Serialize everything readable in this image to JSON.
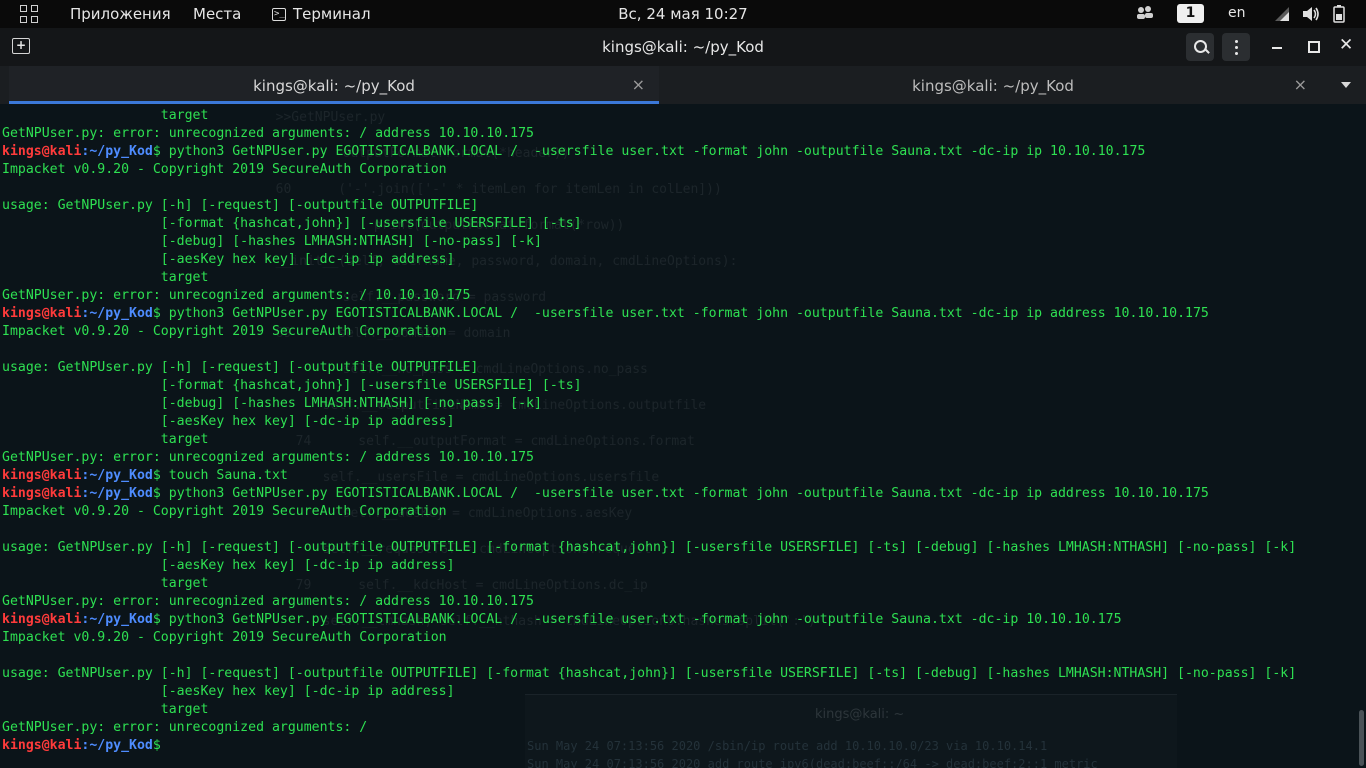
{
  "topbar": {
    "apps_label": "Приложения",
    "places_label": "Места",
    "terminal_label": "Терминал",
    "clock": "Вс, 24 мая  10:27",
    "workspace": "1",
    "language": "en"
  },
  "window": {
    "title": "kings@kali: ~/py_Kod"
  },
  "tabs": [
    {
      "label": "kings@kali: ~/py_Kod",
      "close": "×"
    },
    {
      "label": "kings@kali: ~/py_Kod",
      "close": "×"
    }
  ],
  "prompt": {
    "user": "kings@kali",
    "path": ":~/py_Kod",
    "symbol": "$"
  },
  "terminal_lines": [
    {
      "type": "out",
      "text": "                    target"
    },
    {
      "type": "out",
      "text": "GetNPUser.py: error: unrecognized arguments: / address 10.10.10.175"
    },
    {
      "type": "cmd",
      "text": " python3 GetNPUser.py EGOTISTICALBANK.LOCAL /  -usersfile user.txt -format john -outputfile Sauna.txt -dc-ip ip 10.10.10.175"
    },
    {
      "type": "out",
      "text": "Impacket v0.9.20 - Copyright 2019 SecureAuth Corporation"
    },
    {
      "type": "out",
      "text": ""
    },
    {
      "type": "out",
      "text": "usage: GetNPUser.py [-h] [-request] [-outputfile OUTPUTFILE]"
    },
    {
      "type": "out",
      "text": "                    [-format {hashcat,john}] [-usersfile USERSFILE] [-ts]"
    },
    {
      "type": "out",
      "text": "                    [-debug] [-hashes LMHASH:NTHASH] [-no-pass] [-k]"
    },
    {
      "type": "out",
      "text": "                    [-aesKey hex key] [-dc-ip ip address]"
    },
    {
      "type": "out",
      "text": "                    target"
    },
    {
      "type": "out",
      "text": "GetNPUser.py: error: unrecognized arguments: / 10.10.10.175"
    },
    {
      "type": "cmd",
      "text": " python3 GetNPUser.py EGOTISTICALBANK.LOCAL /  -usersfile user.txt -format john -outputfile Sauna.txt -dc-ip ip address 10.10.10.175"
    },
    {
      "type": "out",
      "text": "Impacket v0.9.20 - Copyright 2019 SecureAuth Corporation"
    },
    {
      "type": "out",
      "text": ""
    },
    {
      "type": "out",
      "text": "usage: GetNPUser.py [-h] [-request] [-outputfile OUTPUTFILE]"
    },
    {
      "type": "out",
      "text": "                    [-format {hashcat,john}] [-usersfile USERSFILE] [-ts]"
    },
    {
      "type": "out",
      "text": "                    [-debug] [-hashes LMHASH:NTHASH] [-no-pass] [-k]"
    },
    {
      "type": "out",
      "text": "                    [-aesKey hex key] [-dc-ip ip address]"
    },
    {
      "type": "out",
      "text": "                    target"
    },
    {
      "type": "out",
      "text": "GetNPUser.py: error: unrecognized arguments: / address 10.10.10.175"
    },
    {
      "type": "cmd",
      "text": " touch Sauna.txt"
    },
    {
      "type": "cmd",
      "text": " python3 GetNPUser.py EGOTISTICALBANK.LOCAL /  -usersfile user.txt -format john -outputfile Sauna.txt -dc-ip ip address 10.10.10.175"
    },
    {
      "type": "out",
      "text": "Impacket v0.9.20 - Copyright 2019 SecureAuth Corporation"
    },
    {
      "type": "out",
      "text": ""
    },
    {
      "type": "out",
      "text": "usage: GetNPUser.py [-h] [-request] [-outputfile OUTPUTFILE] [-format {hashcat,john}] [-usersfile USERSFILE] [-ts] [-debug] [-hashes LMHASH:NTHASH] [-no-pass] [-k]"
    },
    {
      "type": "out",
      "text": "                    [-aesKey hex key] [-dc-ip ip address]"
    },
    {
      "type": "out",
      "text": "                    target"
    },
    {
      "type": "out",
      "text": "GetNPUser.py: error: unrecognized arguments: / address 10.10.10.175"
    },
    {
      "type": "cmd",
      "text": " python3 GetNPUser.py EGOTISTICALBANK.LOCAL /  -usersfile user.txt -format john -outputfile Sauna.txt -dc-ip 10.10.10.175"
    },
    {
      "type": "out",
      "text": "Impacket v0.9.20 - Copyright 2019 SecureAuth Corporation"
    },
    {
      "type": "out",
      "text": ""
    },
    {
      "type": "out",
      "text": "usage: GetNPUser.py [-h] [-request] [-outputfile OUTPUTFILE] [-format {hashcat,john}] [-usersfile USERSFILE] [-ts] [-debug] [-hashes LMHASH:NTHASH] [-no-pass] [-k]"
    },
    {
      "type": "out",
      "text": "                    [-aesKey hex key] [-dc-ip ip address]"
    },
    {
      "type": "out",
      "text": "                    target"
    },
    {
      "type": "out",
      "text": "GetNPUser.py: error: unrecognized arguments: /"
    },
    {
      "type": "cmd",
      "text": " "
    }
  ],
  "background_ghost": [
    "  >>GetNPUser.py",
    "        outputFormat.format(*header))",
    "  60      ('-'.join(['-' * itemLen for itemLen in colLen]))",
    "            print(outputFormat.format(*row))",
    "  __init__(self, username, password, domain, cmdLineOptions):",
    "        self.__password = password",
    "  69      self.__domain = domain",
    "        self.__no_pass = cmdLineOptions.no_pass",
    "        self.__outputFileName = cmdLineOptions.outputfile",
    "  74      self.__outputFormat = cmdLineOptions.format",
    "        self.__usersFile = cmdLineOptions.usersfile",
    "        self.__aesKey = cmdLineOptions.aesKey",
    "        self.__requestTGT = cmdLineOptions.request",
    "  79      self.__kdcHost = cmdLineOptions.dc_ip",
    "        self.__lmhash, self.__nthash = cmdLineOptions.hashes.split(':')"
  ],
  "ghost_window": {
    "title": "kings@kali: ~",
    "lines": [
      "Sun May 24 07:13:56 2020 /sbin/ip route add 10.10.10.0/23 via 10.10.14.1",
      "Sun May 24 07:13:56 2020 add_route_ipv6(dead:beef::/64 -> dead:beef:2::1 metric"
    ]
  },
  "colors": {
    "terminal_bg": "#0b1419",
    "output_green": "#2ee052",
    "prompt_user_red": "#ff3b3b",
    "prompt_path_blue": "#4e8cff",
    "tab_accent": "#3b78d8"
  }
}
